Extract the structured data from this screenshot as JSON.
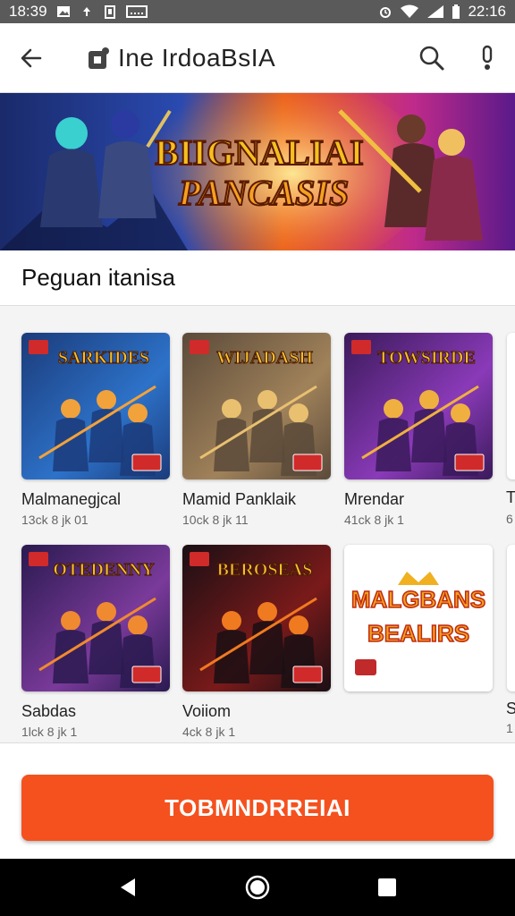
{
  "status_bar": {
    "time": "18:39",
    "right_time": "22:16",
    "icons": [
      "photo-icon",
      "upload-icon",
      "clipboard-icon",
      "wifi-icon",
      "signal-icon",
      "battery-icon"
    ]
  },
  "app_bar": {
    "title": "Ine IrdoaBsIA",
    "icons": [
      "back-arrow-icon",
      "app-logo-icon",
      "search-icon",
      "more-vert-icon"
    ]
  },
  "banner": {
    "line1": "BIIGNALIAI",
    "line2": "PANCASIS"
  },
  "section": {
    "title": "Peguan itanisa"
  },
  "games": [
    {
      "name": "Malmanegjcal",
      "meta": "13ck 8 jk 01",
      "art_title": "SARKIDES",
      "colors": [
        "#1b3b7a",
        "#2d72c9",
        "#f2a23a"
      ]
    },
    {
      "name": "Mamid Panklaik",
      "meta": "10ck 8 jk 11",
      "art_title": "WIJADASH",
      "colors": [
        "#5b4a3a",
        "#a0825a",
        "#e8c070"
      ]
    },
    {
      "name": "Mrendar",
      "meta": "41ck 8 jk 1",
      "art_title": "TOWSIRDE",
      "colors": [
        "#3a1a5a",
        "#8a3ab8",
        "#f0b040"
      ]
    },
    {
      "name": "Sabdas",
      "meta": "1lck 8 jk 1",
      "art_title": "OTEDENNY",
      "colors": [
        "#2a1a50",
        "#7a3a9a",
        "#f08a30"
      ]
    },
    {
      "name": "Voiiom",
      "meta": "4ck 8 jk 1",
      "art_title": "BEROSEAS",
      "colors": [
        "#1a0f14",
        "#7a1a1a",
        "#f07a20"
      ]
    },
    {
      "name": "",
      "meta": "",
      "art_title": "MALGBANS",
      "art_title2": "BEALIRS",
      "colors": [
        "#ffffff",
        "#ffffff",
        "#f0a020"
      ]
    }
  ],
  "peek_labels": {
    "top": "T",
    "top_meta": "6",
    "bottom": "S",
    "bottom_meta": "1"
  },
  "cta": {
    "label": "TOBMNDRREIAI"
  },
  "nav": {
    "icons": [
      "nav-back-icon",
      "nav-home-icon",
      "nav-recents-icon"
    ]
  },
  "colors": {
    "accent": "#f4511e",
    "status_bar": "#5a5a5a"
  }
}
